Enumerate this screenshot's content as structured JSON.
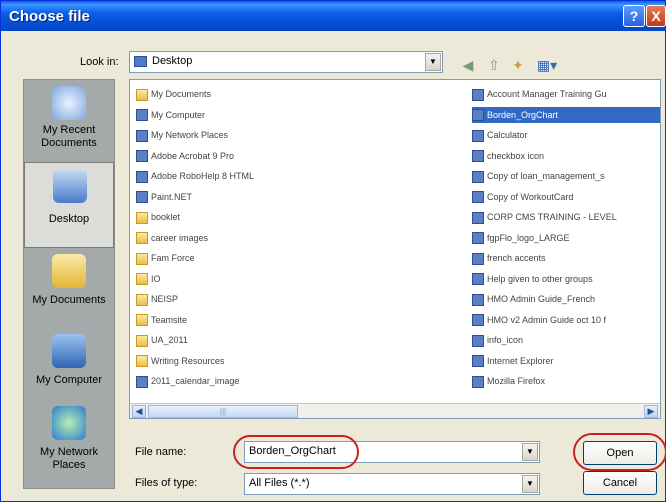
{
  "window": {
    "title": "Choose file",
    "help_label": "?",
    "close_label": "X"
  },
  "toolbar": {
    "look_in_label": "Look in:",
    "look_in_value": "Desktop"
  },
  "places": [
    {
      "label": "My Recent Documents"
    },
    {
      "label": "Desktop"
    },
    {
      "label": "My Documents"
    },
    {
      "label": "My Computer"
    },
    {
      "label": "My Network Places"
    }
  ],
  "files_left": [
    {
      "name": "My Documents",
      "icon": "folder-icon"
    },
    {
      "name": "My Computer",
      "icon": "computer-icon"
    },
    {
      "name": "My Network Places",
      "icon": "network-icon"
    },
    {
      "name": "Adobe Acrobat 9 Pro",
      "icon": "shortcut-icon"
    },
    {
      "name": "Adobe RoboHelp 8 HTML",
      "icon": "shortcut-icon"
    },
    {
      "name": "Paint.NET",
      "icon": "shortcut-icon"
    },
    {
      "name": "booklet",
      "icon": "folder-icon"
    },
    {
      "name": "career images",
      "icon": "folder-icon"
    },
    {
      "name": "Fam Force",
      "icon": "folder-icon"
    },
    {
      "name": "IO",
      "icon": "folder-icon"
    },
    {
      "name": "NEISP",
      "icon": "folder-icon"
    },
    {
      "name": "Teamsite",
      "icon": "folder-icon"
    },
    {
      "name": "UA_2011",
      "icon": "folder-icon"
    },
    {
      "name": "Writing Resources",
      "icon": "folder-icon"
    },
    {
      "name": "2011_calendar_image",
      "icon": "image-icon"
    }
  ],
  "files_right": [
    {
      "name": "Account Manager Training Gu",
      "icon": "document-icon"
    },
    {
      "name": "Borden_OrgChart",
      "icon": "document-icon",
      "selected": true
    },
    {
      "name": "Calculator",
      "icon": "document-icon"
    },
    {
      "name": "checkbox icon",
      "icon": "document-icon"
    },
    {
      "name": "Copy of loan_management_s",
      "icon": "document-icon"
    },
    {
      "name": "Copy of WorkoutCard",
      "icon": "document-icon"
    },
    {
      "name": "CORP CMS TRAINING - LEVEL",
      "icon": "document-icon"
    },
    {
      "name": "fgpFlo_logo_LARGE",
      "icon": "document-icon"
    },
    {
      "name": "french accents",
      "icon": "document-icon"
    },
    {
      "name": "Help given to other groups",
      "icon": "document-icon"
    },
    {
      "name": "HMO Admin Guide_French",
      "icon": "document-icon"
    },
    {
      "name": "HMO v2 Admin Guide oct 10 f",
      "icon": "document-icon"
    },
    {
      "name": "info_icon",
      "icon": "document-icon"
    },
    {
      "name": "Internet Explorer",
      "icon": "document-icon"
    },
    {
      "name": "Mozilla Firefox",
      "icon": "document-icon"
    }
  ],
  "bottom": {
    "filename_label": "File name:",
    "filename_value": "Borden_OrgChart",
    "filetype_label": "Files of type:",
    "filetype_value": "All Files (*.*)",
    "open_label": "Open",
    "cancel_label": "Cancel"
  },
  "colors": {
    "title_bar": "#0a5fe8",
    "selection": "#316ac5",
    "annotation": "#c8201e"
  }
}
